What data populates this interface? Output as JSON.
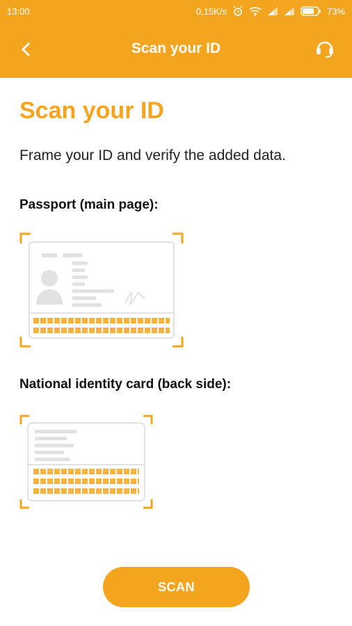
{
  "status_bar": {
    "time": "13:00",
    "network_speed": "0,15K/s",
    "battery": "73%",
    "icons": [
      "alarm-icon",
      "wifi-icon",
      "signal-icon",
      "signal-icon",
      "battery-icon"
    ]
  },
  "app_bar": {
    "title": "Scan your ID",
    "back_icon": "chevron-left-icon",
    "support_icon": "headset-icon"
  },
  "main": {
    "title": "Scan your ID",
    "subtitle": "Frame your ID and verify the added data.",
    "passport_label": "Passport (main page):",
    "id_card_label": "National identity card (back side):"
  },
  "actions": {
    "scan_label": "SCAN"
  },
  "colors": {
    "accent": "#f4a51f",
    "illustration": "#dddddd"
  }
}
